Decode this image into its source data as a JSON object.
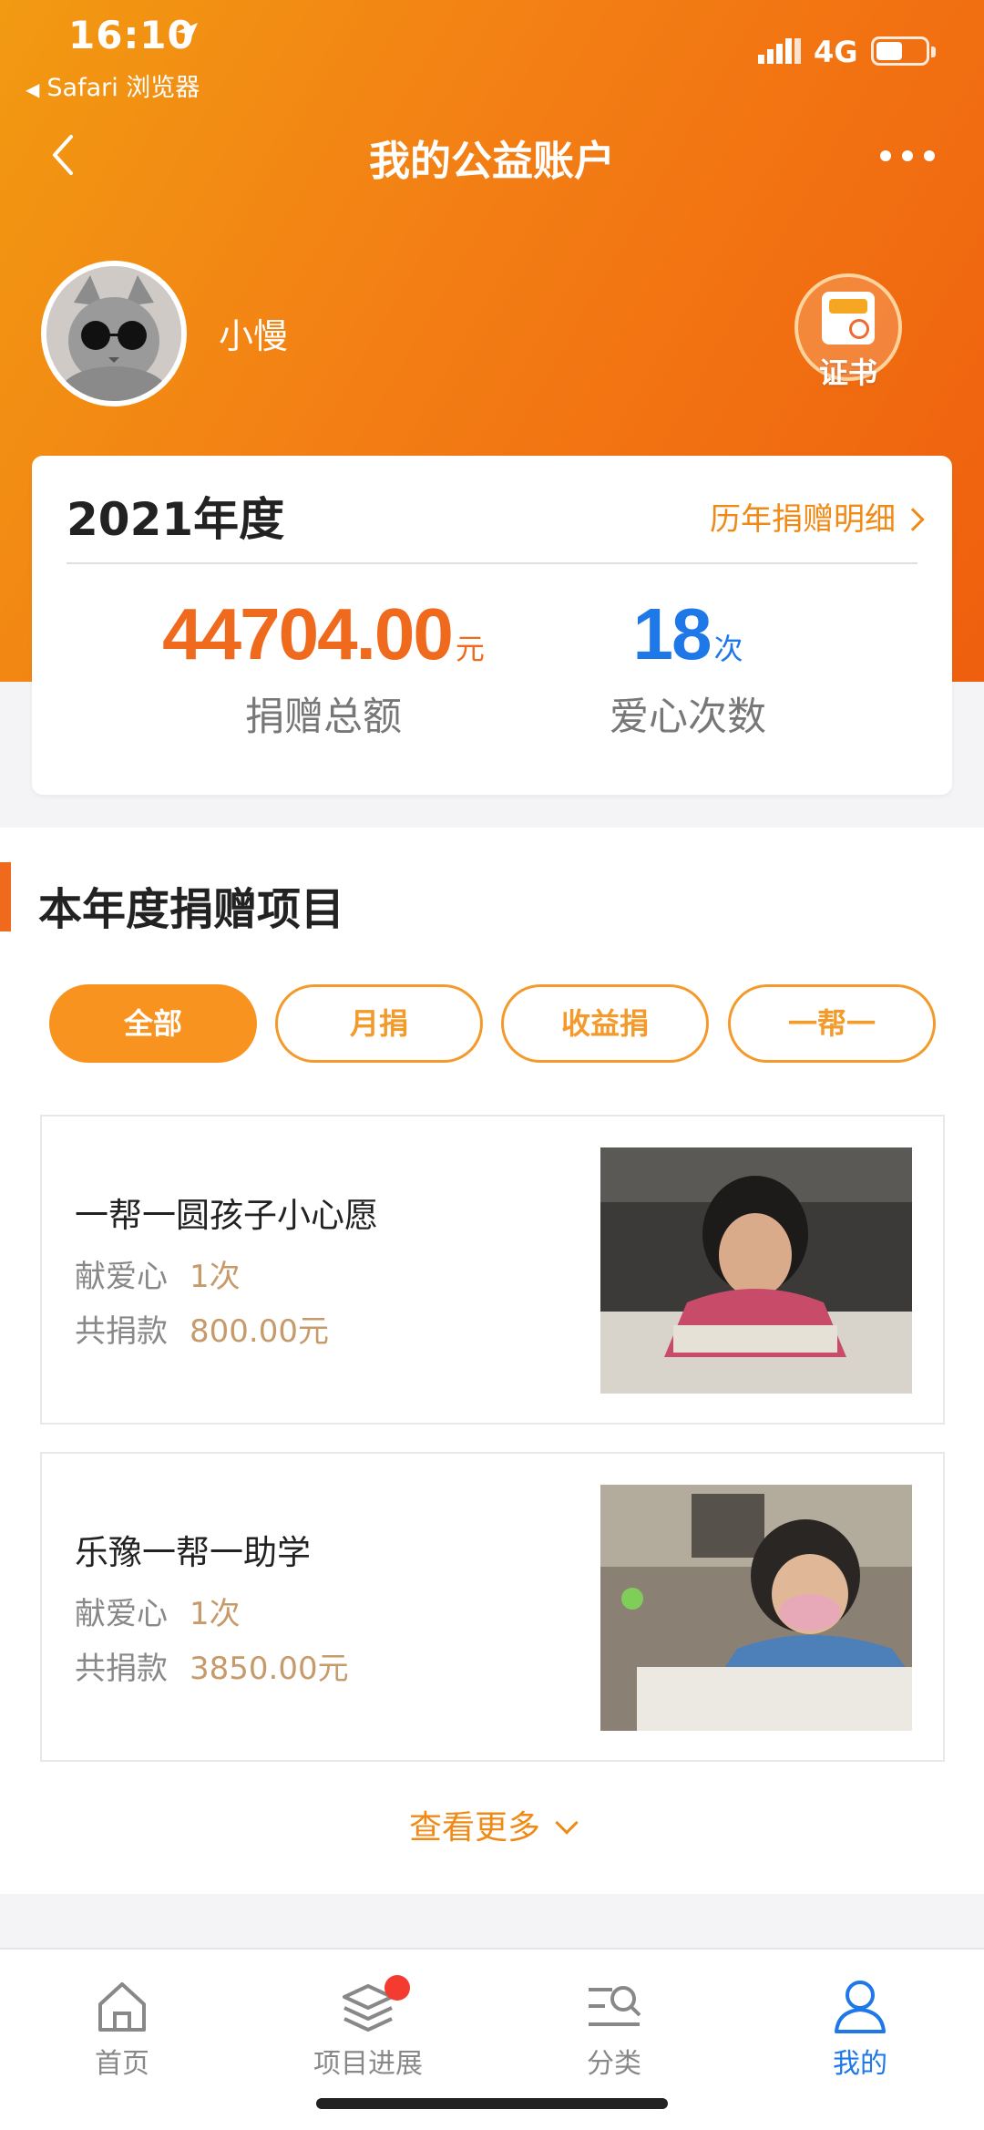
{
  "status_bar": {
    "time": "16:10",
    "back_app": "Safari 浏览器",
    "network": "4G"
  },
  "nav": {
    "title": "我的公益账户"
  },
  "user": {
    "name": "小慢",
    "certificate_label": "证书"
  },
  "summary": {
    "year": "2021年度",
    "history_link": "历年捐赠明细",
    "total_amount": "44704.00",
    "total_unit": "元",
    "total_label": "捐赠总额",
    "count": "18",
    "count_unit": "次",
    "count_label": "爱心次数"
  },
  "projects_section": {
    "title": "本年度捐赠项目",
    "filters": [
      "全部",
      "月捐",
      "收益捐",
      "一帮一"
    ],
    "active_filter": "全部",
    "items": [
      {
        "title": "一帮一圆孩子小心愿",
        "times_label": "献爱心",
        "times_value": "1次",
        "amount_label": "共捐款",
        "amount_value": "800.00元"
      },
      {
        "title": "乐豫一帮一助学",
        "times_label": "献爱心",
        "times_value": "1次",
        "amount_label": "共捐款",
        "amount_value": "3850.00元"
      }
    ],
    "more_label": "查看更多"
  },
  "tabbar": {
    "items": [
      {
        "label": "首页",
        "icon": "home-icon"
      },
      {
        "label": "项目进展",
        "icon": "layers-icon"
      },
      {
        "label": "分类",
        "icon": "category-search-icon"
      },
      {
        "label": "我的",
        "icon": "user-icon"
      }
    ],
    "active": "我的"
  },
  "colors": {
    "brand_orange": "#f06a1e",
    "accent_blue": "#1e78e8",
    "pill_orange": "#f7931e"
  }
}
